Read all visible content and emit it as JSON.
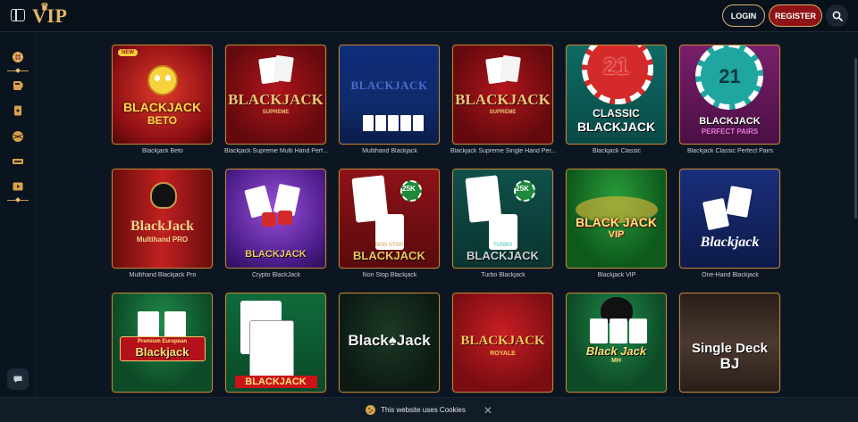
{
  "header": {
    "logo_text": "VIP",
    "login_label": "LOGIN",
    "register_label": "REGISTER",
    "search_icon": "search-icon",
    "menu_icon": "sidebar-toggle-icon"
  },
  "sidebar": {
    "items": [
      {
        "icon": "roulette-wheel-icon"
      },
      {
        "icon": "slot-icon"
      },
      {
        "icon": "card-icon"
      },
      {
        "icon": "sports-ball-icon"
      },
      {
        "icon": "lottery-icon"
      },
      {
        "icon": "live-video-icon"
      }
    ],
    "chat_icon": "chat-icon"
  },
  "games": [
    {
      "caption": "Blackjack Beto",
      "line1": "BLACKJACK",
      "line2": "BETO",
      "badge": "NEW"
    },
    {
      "caption": "Blackjack Supreme Multi Hand Perf...",
      "line1": "BLACKJACK",
      "line2": "SUPREME"
    },
    {
      "caption": "Multihand Blackjack",
      "line1": "BLACKJACK",
      "line2": ""
    },
    {
      "caption": "Blackjack Supreme Single Hand Per...",
      "line1": "BLACKJACK",
      "line2": "SUPREME"
    },
    {
      "caption": "Blackjack Classic",
      "line1": "CLASSIC",
      "line2": "BLACKJACK",
      "chip": "21"
    },
    {
      "caption": "Blackjack Classic Perfect Pairs",
      "line1": "BLACKJACK",
      "line2": "PERFECT PAIRS",
      "chip": "21"
    },
    {
      "caption": "Multihand Blackjack Pro",
      "line1": "BlackJack",
      "line2": "Multihand PRO"
    },
    {
      "caption": "Crypto BlackJack",
      "line1": "BLACKJACK",
      "line2": ""
    },
    {
      "caption": "Non Stop Blackjack",
      "line1": "BLACKJACK",
      "line2": "NON STOP",
      "chip": "25K"
    },
    {
      "caption": "Turbo Blackjack",
      "line1": "BLACKJACK",
      "line2": "TURBO",
      "chip": "25K"
    },
    {
      "caption": "Blackjack VIP",
      "line1": "BLACK JACK",
      "line2": "VIP"
    },
    {
      "caption": "One-Hand Blackjack",
      "line1": "Blackjack",
      "line2": ""
    },
    {
      "caption": "",
      "line1": "Blackjack",
      "line2": "Premium European"
    },
    {
      "caption": "",
      "line1": "BLACKJACK",
      "line2": ""
    },
    {
      "caption": "",
      "line1": "Black♠Jack",
      "line2": ""
    },
    {
      "caption": "",
      "line1": "BLACKJACK",
      "line2": "ROYALE"
    },
    {
      "caption": "",
      "line1": "Black Jack",
      "line2": "MH"
    },
    {
      "caption": "",
      "line1": "Single Deck",
      "line2": "BJ"
    }
  ],
  "cookie": {
    "text": "This website uses Cookies",
    "close": "✕"
  },
  "colors": {
    "background": "#0b1622",
    "gold_accent": "#d8b26a",
    "register_red": "#8e1216"
  }
}
